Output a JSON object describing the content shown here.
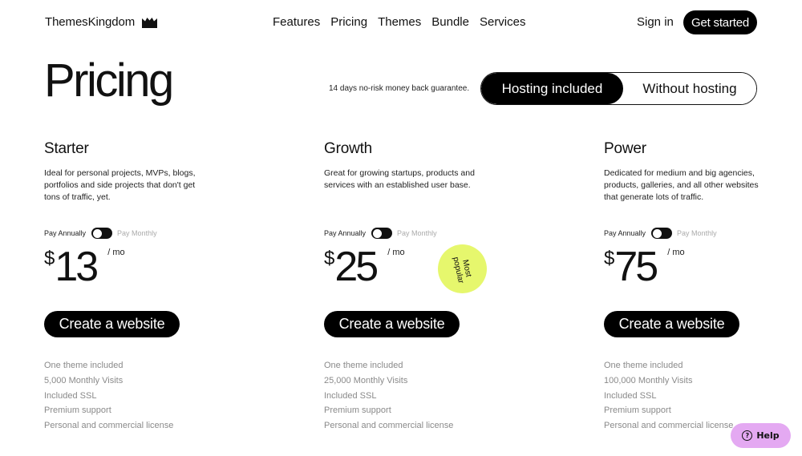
{
  "header": {
    "brand": "ThemesKingdom",
    "brand_icon": "crown-icon",
    "nav": [
      "Features",
      "Pricing",
      "Themes",
      "Bundle",
      "Services"
    ],
    "sign_in": "Sign in",
    "get_started": "Get started"
  },
  "hero": {
    "title": "Pricing",
    "guarantee": "14 days no-risk money back guarantee.",
    "hosting_toggle": {
      "options": [
        "Hosting included",
        "Without hosting"
      ],
      "selected": "Hosting included"
    }
  },
  "plans": [
    {
      "name": "Starter",
      "description": "Ideal for personal projects, MVPs, blogs, portfolios and side projects that don't get tons of traffic, yet.",
      "billing": {
        "annual": "Pay Annually",
        "monthly": "Pay Monthly",
        "selected": "Pay Annually"
      },
      "currency": "$",
      "price": "13",
      "period": "/ mo",
      "cta": "Create a website",
      "features": [
        "One theme included",
        "5,000 Monthly Visits",
        "Included SSL",
        "Premium support",
        "Personal and commercial license"
      ]
    },
    {
      "name": "Growth",
      "description": "Great for growing startups, products and services with an established user base.",
      "billing": {
        "annual": "Pay Annually",
        "monthly": "Pay Monthly",
        "selected": "Pay Annually"
      },
      "currency": "$",
      "price": "25",
      "period": "/ mo",
      "badge": "Most popular",
      "cta": "Create a website",
      "features": [
        "One theme included",
        "25,000 Monthly Visits",
        "Included SSL",
        "Premium support",
        "Personal and commercial license"
      ]
    },
    {
      "name": "Power",
      "description": "Dedicated for medium and big agencies, products, galleries, and all other websites that generate lots of traffic.",
      "billing": {
        "annual": "Pay Annually",
        "monthly": "Pay Monthly",
        "selected": "Pay Annually"
      },
      "currency": "$",
      "price": "75",
      "period": "/ mo",
      "cta": "Create a website",
      "features": [
        "One theme included",
        "100,000 Monthly Visits",
        "Included SSL",
        "Premium support",
        "Personal and commercial license"
      ]
    }
  ],
  "help": {
    "label": "Help",
    "icon": "question-circle-icon"
  },
  "colors": {
    "accent_badge": "#e6f76d",
    "help_button": "#e4a9f2",
    "primary": "#000000",
    "muted_text": "#8a8a8a"
  }
}
